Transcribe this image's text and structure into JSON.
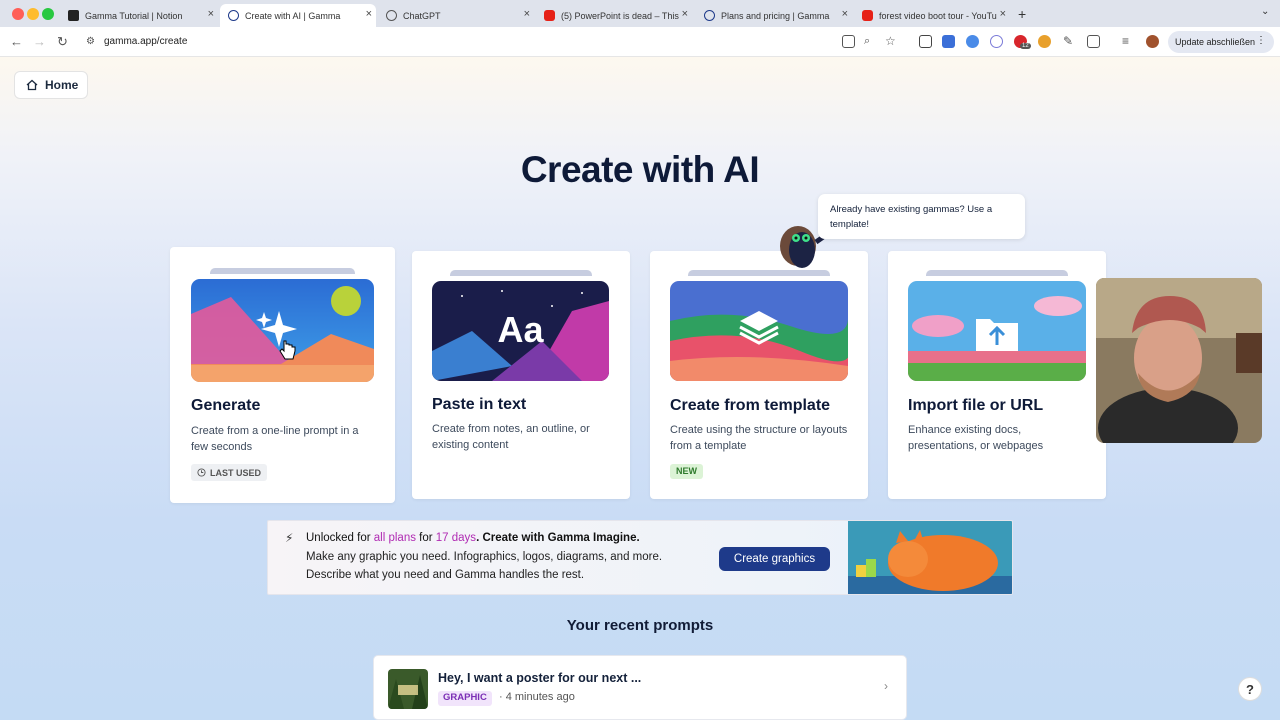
{
  "browser": {
    "tabs": [
      {
        "title": "Gamma Tutorial | Notion",
        "favicon": "notion-icon",
        "active": false
      },
      {
        "title": "Create with AI | Gamma",
        "favicon": "gamma-icon",
        "active": true
      },
      {
        "title": "ChatGPT",
        "favicon": "chatgpt-icon",
        "active": false
      },
      {
        "title": "(5) PowerPoint is dead – This",
        "favicon": "youtube-icon",
        "active": false
      },
      {
        "title": "Plans and pricing | Gamma",
        "favicon": "gamma-icon",
        "active": false
      },
      {
        "title": "forest video boot tour - YouTu",
        "favicon": "youtube-icon",
        "active": false
      }
    ],
    "url": "gamma.app/create",
    "update_button": "Update abschließen",
    "extension_badge": "12"
  },
  "page": {
    "home_label": "Home",
    "title": "Create with AI",
    "tooltip": "Already have existing gammas? Use a template!",
    "cards": [
      {
        "title": "Generate",
        "description": "Create from a one-line prompt in a few seconds",
        "badge": "LAST USED"
      },
      {
        "title": "Paste in text",
        "description": "Create from notes, an outline, or existing content",
        "thumb_text": "Aa"
      },
      {
        "title": "Create from template",
        "description": "Create using the structure or layouts from a template",
        "badge": "NEW"
      },
      {
        "title": "Import file or URL",
        "description": "Enhance existing docs, presentations, or webpages"
      }
    ],
    "banner": {
      "unlocked": "Unlocked for ",
      "all_plans": "all plans",
      "for": " for ",
      "days": "17 days",
      "rest": ". Create with Gamma Imagine.",
      "line2": "Make any graphic you need. Infographics, logos, diagrams, and more.",
      "line3": "Describe what you need and Gamma handles the rest.",
      "button": "Create graphics"
    },
    "recent": {
      "title": "Your recent prompts",
      "items": [
        {
          "text": "Hey, I want a poster for our next ...",
          "tag": "GRAPHIC",
          "time": "· 4 minutes ago"
        }
      ]
    },
    "help_label": "?"
  },
  "colors": {
    "accent": "#1e3a8a",
    "highlight": "#b02bb3",
    "new_badge": "#2e7a2c",
    "graphic_tag": "#7b2fb5"
  }
}
